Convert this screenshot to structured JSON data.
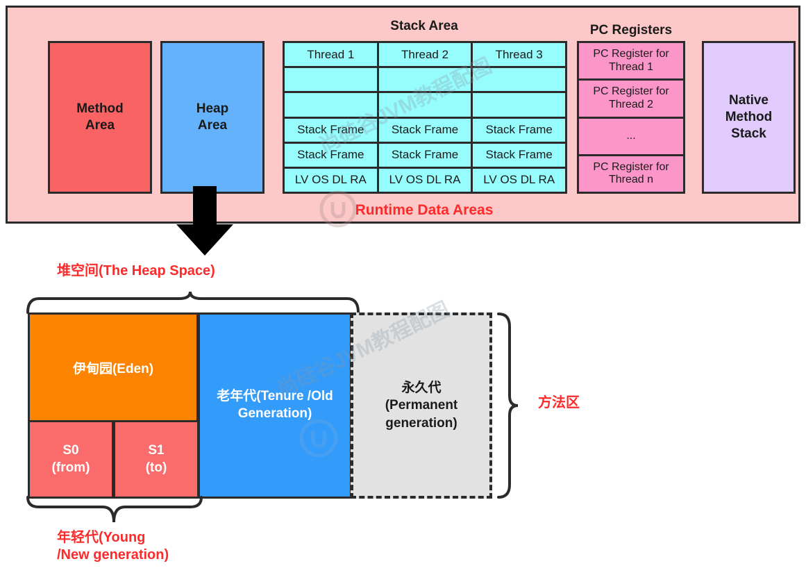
{
  "runtime_panel": {
    "title_label": "Runtime Data Areas",
    "method_area": "Method\nArea",
    "heap_area": "Heap\nArea",
    "native_method_stack": "Native\nMethod\nStack",
    "stack_area_title": "Stack Area",
    "pc_registers_title": "PC Registers",
    "stack_area": {
      "columns": [
        {
          "header": "Thread 1",
          "cells": [
            "Thread 1",
            "",
            "",
            "Stack Frame",
            "Stack Frame",
            "LV OS DL RA"
          ]
        },
        {
          "header": "Thread 2",
          "cells": [
            "Thread 2",
            "",
            "",
            "Stack Frame",
            "Stack Frame",
            "LV OS DL RA"
          ]
        },
        {
          "header": "Thread 3",
          "cells": [
            "Thread 3",
            "",
            "",
            "Stack Frame",
            "Stack Frame",
            "LV OS DL RA"
          ]
        }
      ]
    },
    "pc_registers": {
      "cells": [
        "PC Register for Thread 1",
        "PC Register for Thread 2",
        "...",
        "PC Register for Thread n"
      ]
    }
  },
  "heap_detail": {
    "heap_space_label": "堆空间(The Heap Space)",
    "method_area_label": "方法区",
    "young_gen_label": "年轻代(Young\n/New generation)",
    "eden": "伊甸园(Eden)",
    "s0": "S0\n(from)",
    "s1": "S1\n(to)",
    "old_generation": "老年代(Tenure /Old Generation)",
    "permanent_generation": "永久代\n(Permanent generation)"
  },
  "watermarks": {
    "text_top": "尚硅谷JVM教程配图",
    "text_mid": "尚硅谷JVM教程配图"
  },
  "colors": {
    "panel_bg": "#fcc8c8",
    "method_area": "#fa6364",
    "heap_area": "#65b2fc",
    "stack_cell": "#96fcfc",
    "pc_cell": "#fc95c8",
    "native_stack": "#e0cbfc",
    "eden": "#fc8400",
    "survivor": "#fa6b6b",
    "old_gen": "#339bfa",
    "perm_gen": "#e2e2e2",
    "red_text": "#fb2b2b",
    "stroke": "#2b2b2b"
  }
}
